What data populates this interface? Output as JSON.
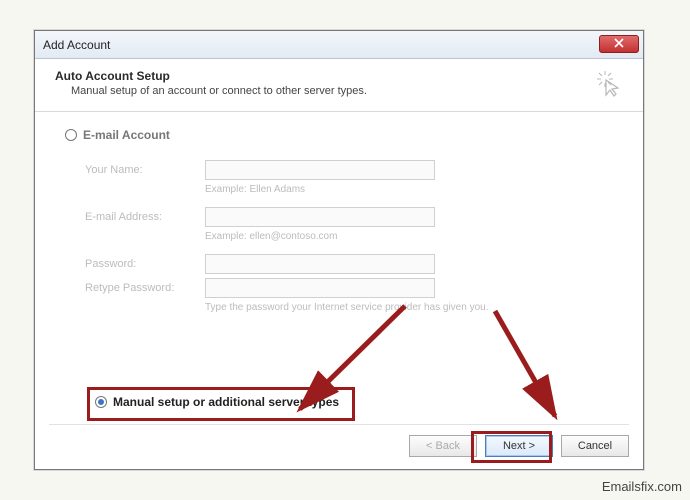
{
  "window": {
    "title": "Add Account"
  },
  "header": {
    "heading": "Auto Account Setup",
    "subtext": "Manual setup of an account or connect to other server types."
  },
  "options": {
    "email_label": "E-mail Account",
    "manual_label": "Manual setup or additional server types"
  },
  "form": {
    "name_label": "Your Name:",
    "name_hint": "Example: Ellen Adams",
    "email_label": "E-mail Address:",
    "email_hint": "Example: ellen@contoso.com",
    "pass_label": "Password:",
    "repass_label": "Retype Password:",
    "pass_hint": "Type the password your Internet service provider has given you."
  },
  "buttons": {
    "back": "< Back",
    "next": "Next >",
    "cancel": "Cancel"
  },
  "watermark": "Emailsfix.com"
}
